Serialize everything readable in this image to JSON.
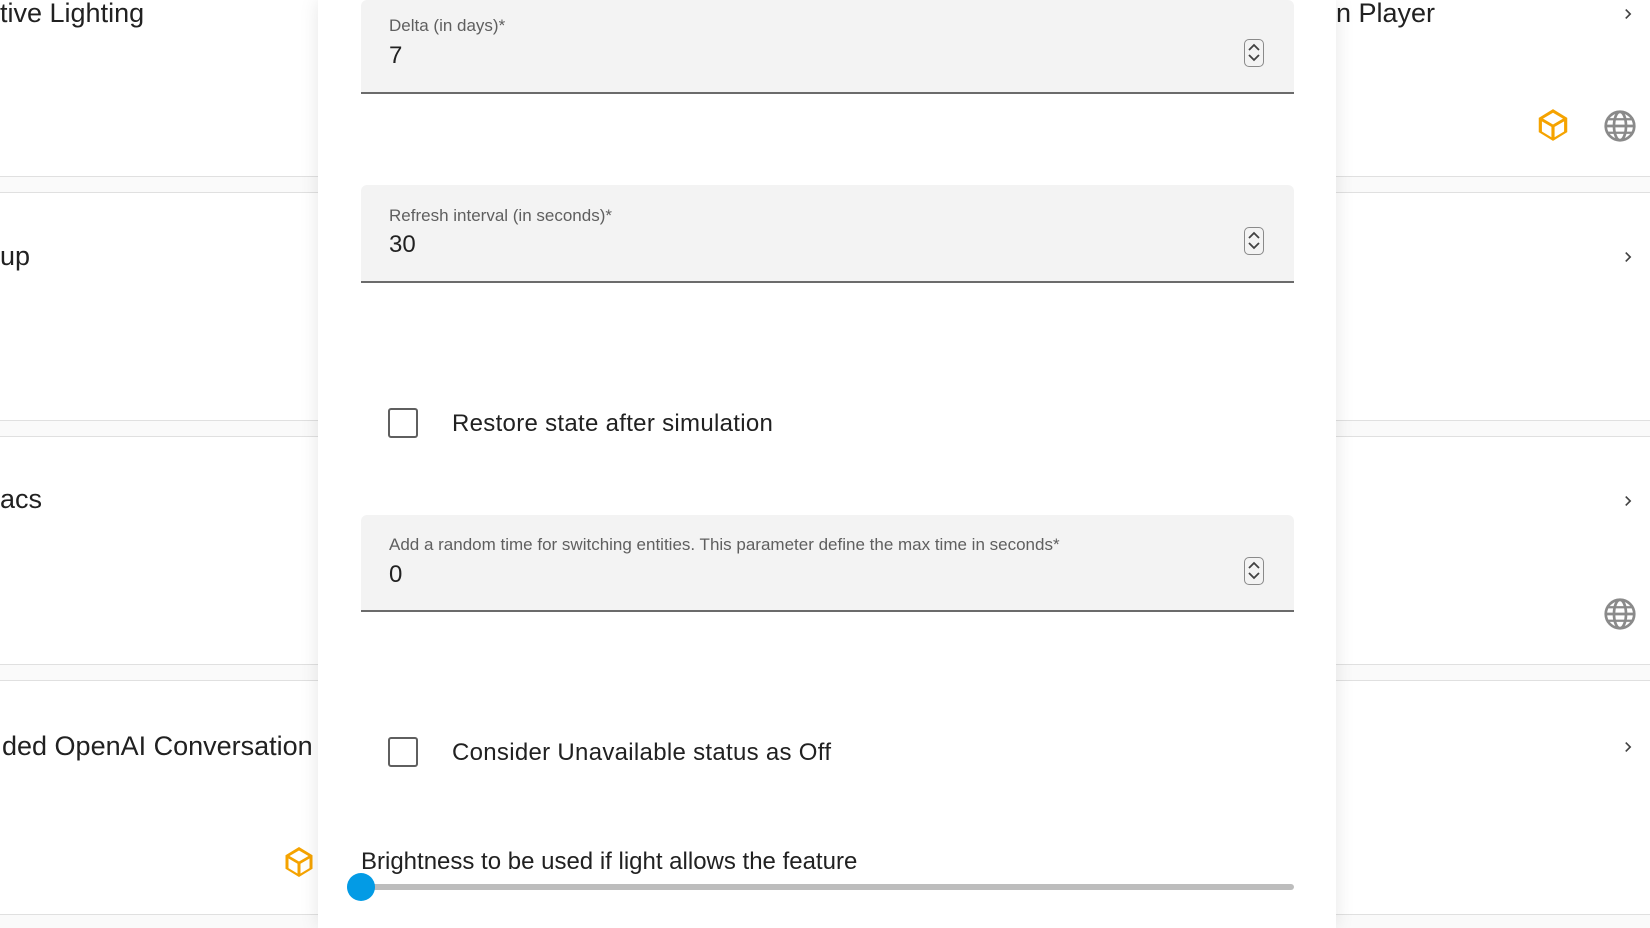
{
  "background": {
    "left_cards": [
      {
        "title": "tive Lighting",
        "has_chevron": true
      },
      {
        "title": "",
        "icons": []
      },
      {
        "title": "up",
        "has_chevron": true
      },
      {
        "title": "acs",
        "has_chevron": true
      },
      {
        "title": "ded OpenAI Conversation",
        "has_chevron": true
      },
      {
        "title": "",
        "icons": [
          "package-icon"
        ]
      }
    ],
    "right_cards": [
      {
        "title": "n Player",
        "has_chevron": true
      },
      {
        "title": "",
        "icons": [
          "package-icon",
          "globe-icon"
        ]
      },
      {
        "title": "",
        "has_chevron": true
      },
      {
        "title": "",
        "has_chevron": true
      },
      {
        "title": "",
        "icons": [
          "globe-icon"
        ]
      },
      {
        "title": "",
        "has_chevron": true
      }
    ]
  },
  "dialog": {
    "delta": {
      "label": "Delta (in days)*",
      "value": "7"
    },
    "refresh": {
      "label": "Refresh interval (in seconds)*",
      "value": "30"
    },
    "restore_state": {
      "label": "Restore state after simulation",
      "checked": false
    },
    "random_time": {
      "label": "Add a random time for switching entities. This parameter define the max time in seconds*",
      "value": "0"
    },
    "unavailable_off": {
      "label": "Consider Unavailable status as Off",
      "checked": false
    },
    "brightness": {
      "label": "Brightness to be used if light allows the feature",
      "value": 0
    }
  },
  "colors": {
    "accent": "#039be5",
    "package_icon": "#f5a300"
  }
}
